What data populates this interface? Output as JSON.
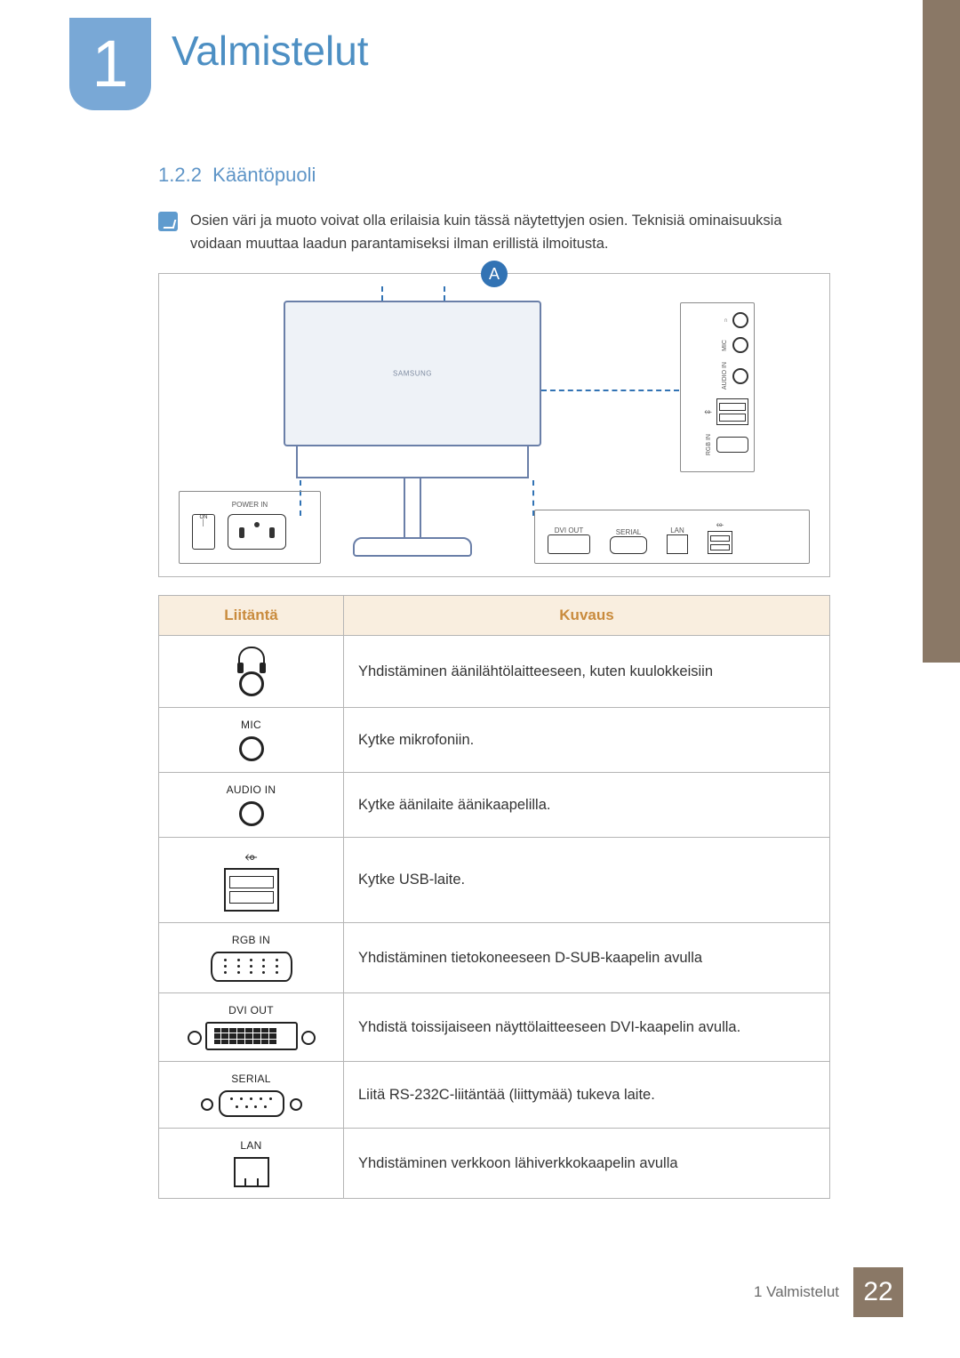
{
  "chapter": {
    "number": "1",
    "title": "Valmistelut"
  },
  "section": {
    "number": "1.2.2",
    "title": "Kääntöpuoli"
  },
  "note": "Osien väri ja muoto voivat olla erilaisia kuin tässä näytettyjen osien. Teknisiä ominaisuuksia voidaan muuttaa laadun parantamiseksi ilman erillistä ilmoitusta.",
  "diagram": {
    "marker": "A",
    "side_panel": {
      "mic": "MIC",
      "audio_in": "AUDIO IN",
      "rgb_in": "RGB IN"
    },
    "power_panel": {
      "label": "POWER IN",
      "switch_on": "ON"
    },
    "bottom_panel": {
      "dvi_out": "DVI OUT",
      "serial": "SERIAL",
      "lan": "LAN"
    }
  },
  "table": {
    "headers": {
      "port": "Liitäntä",
      "desc": "Kuvaus"
    },
    "rows": [
      {
        "label": "",
        "desc": "Yhdistäminen äänilähtölaitteeseen, kuten kuulokkeisiin"
      },
      {
        "label": "MIC",
        "desc": "Kytke mikrofoniin."
      },
      {
        "label": "AUDIO IN",
        "desc": "Kytke äänilaite äänikaapelilla."
      },
      {
        "label": "",
        "desc": "Kytke USB-laite."
      },
      {
        "label": "RGB IN",
        "desc": "Yhdistäminen tietokoneeseen D-SUB-kaapelin avulla"
      },
      {
        "label": "DVI OUT",
        "desc": "Yhdistä toissijaiseen näyttölaitteeseen DVI-kaapelin avulla."
      },
      {
        "label": "SERIAL",
        "desc": "Liitä RS-232C-liitäntää (liittymää) tukeva laite."
      },
      {
        "label": "LAN",
        "desc": "Yhdistäminen verkkoon lähiverkkokaapelin avulla"
      }
    ]
  },
  "footer": {
    "text": "1 Valmistelut",
    "page": "22"
  }
}
